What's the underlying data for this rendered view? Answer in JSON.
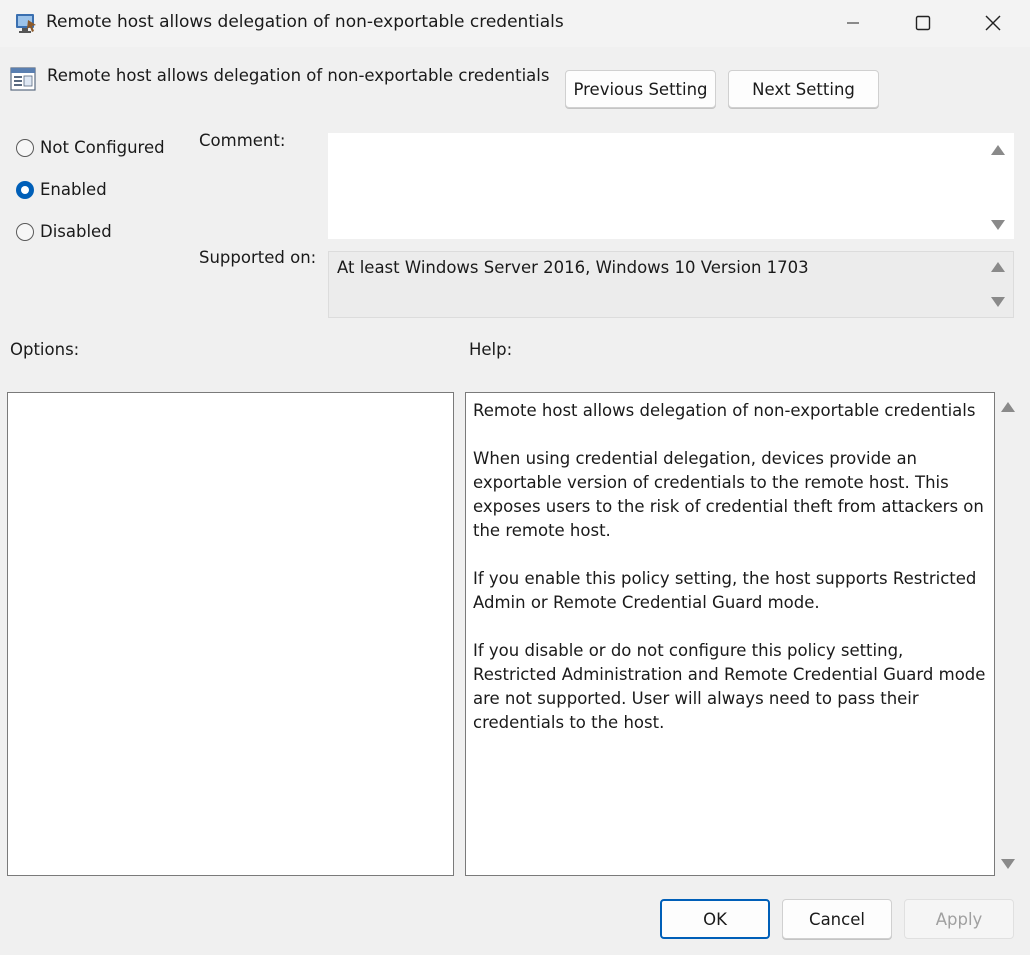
{
  "window": {
    "title": "Remote host allows delegation of non-exportable credentials",
    "controls": {
      "minimize_icon": "minimize-icon",
      "maximize_icon": "maximize-icon",
      "close_icon": "close-icon"
    }
  },
  "header": {
    "policy_title": "Remote host allows delegation of non-exportable credentials",
    "previous_setting_label": "Previous Setting",
    "next_setting_label": "Next Setting"
  },
  "state": {
    "options": [
      {
        "label": "Not Configured",
        "checked": false
      },
      {
        "label": "Enabled",
        "checked": true
      },
      {
        "label": "Disabled",
        "checked": false
      }
    ]
  },
  "comment": {
    "label": "Comment:",
    "value": ""
  },
  "supported_on": {
    "label": "Supported on:",
    "value": "At least Windows Server 2016, Windows 10 Version 1703"
  },
  "options_panel": {
    "label": "Options:"
  },
  "help_panel": {
    "label": "Help:",
    "paragraphs": [
      "Remote host allows delegation of non-exportable credentials",
      "When using credential delegation, devices provide an exportable version of credentials to the remote host. This exposes users to the risk of credential theft from attackers on the remote host.",
      "If you enable this policy setting, the host supports Restricted Admin or Remote Credential Guard mode.",
      "If you disable or do not configure this policy setting, Restricted Administration and Remote Credential Guard mode are not supported. User will always need to pass their credentials to the host."
    ]
  },
  "footer": {
    "ok_label": "OK",
    "cancel_label": "Cancel",
    "apply_label": "Apply",
    "apply_enabled": false
  },
  "colors": {
    "accent": "#005fb8",
    "window_bg": "#f0f0f0",
    "disabled_text": "#a0a0a0"
  }
}
